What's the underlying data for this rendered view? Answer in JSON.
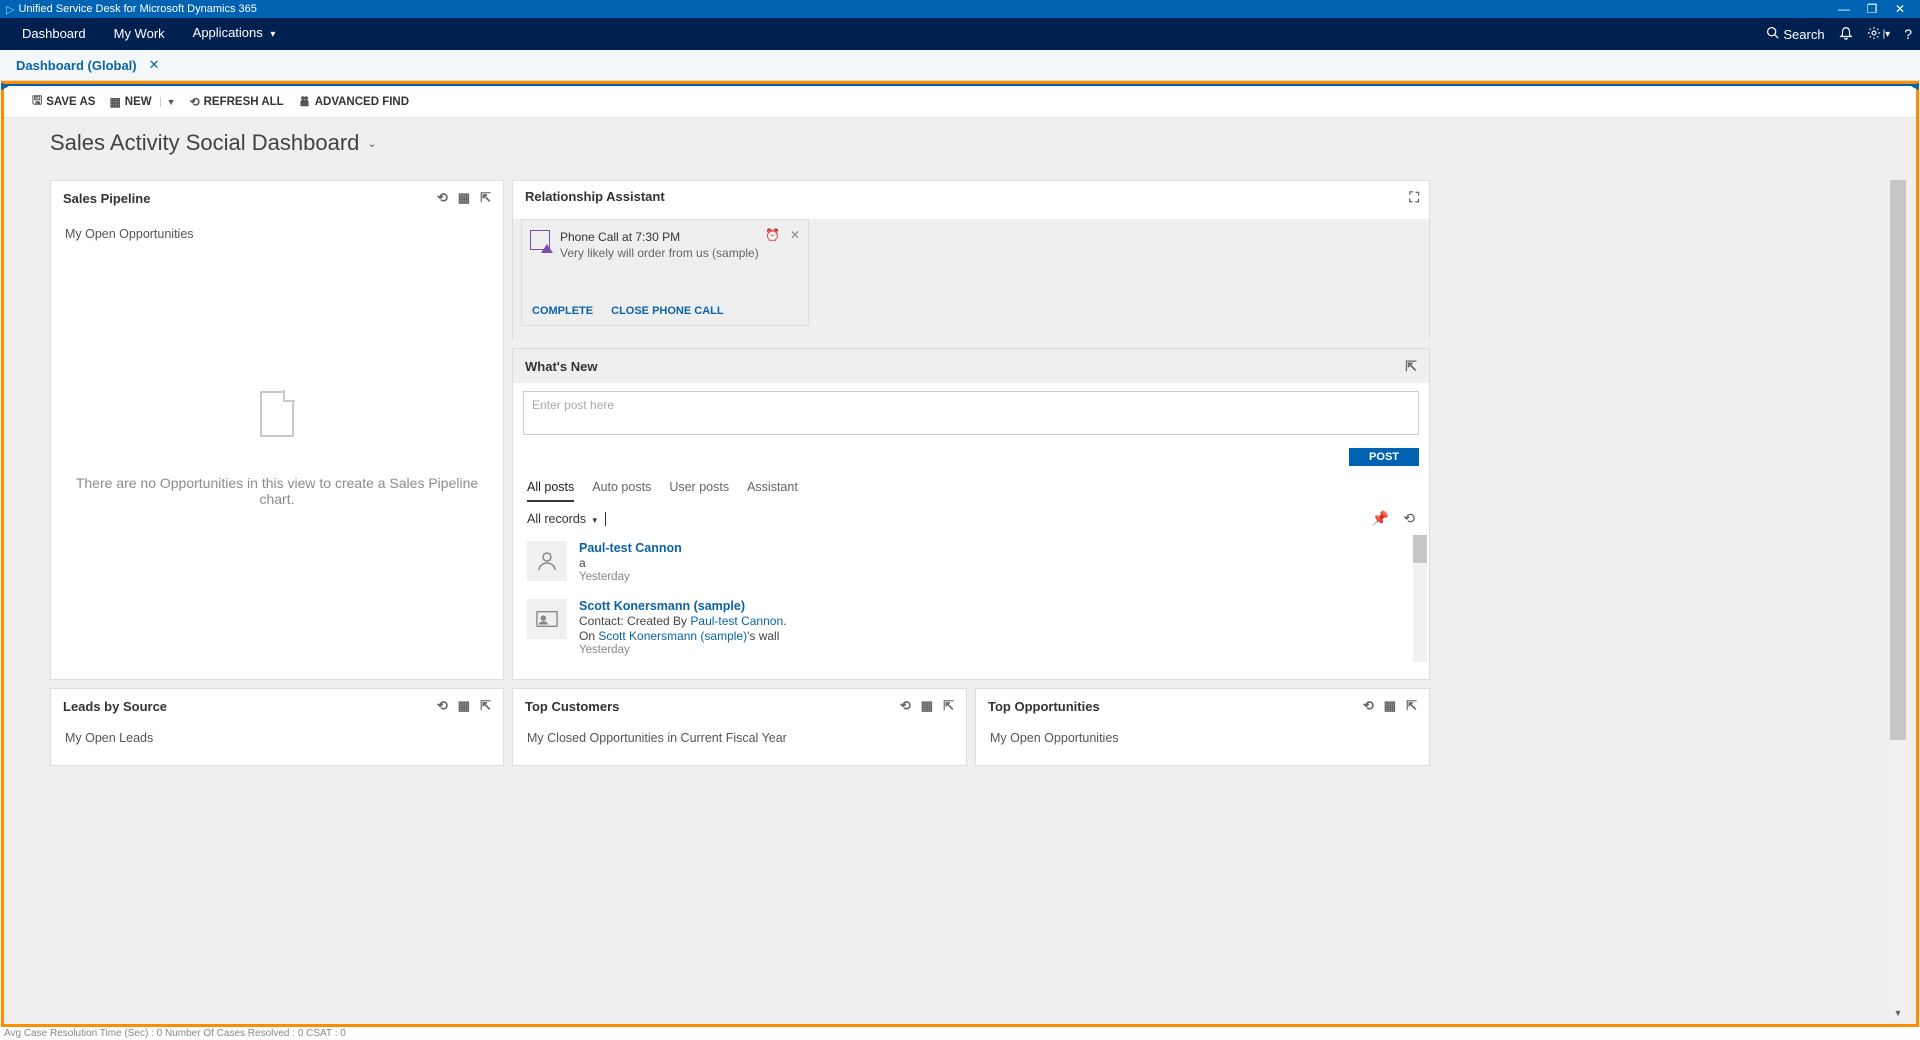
{
  "titlebar": {
    "app_title": "Unified Service Desk for Microsoft Dynamics 365"
  },
  "navbar": {
    "dashboard": "Dashboard",
    "my_work": "My Work",
    "applications": "Applications",
    "search_label": "Search"
  },
  "tabstrip": {
    "tab1": "Dashboard (Global)"
  },
  "toolbar": {
    "save_as": "SAVE AS",
    "new": "NEW",
    "refresh_all": "REFRESH ALL",
    "advanced_find": "ADVANCED FIND"
  },
  "dashboard": {
    "title": "Sales Activity Social Dashboard"
  },
  "sales_pipeline": {
    "title": "Sales Pipeline",
    "subtitle": "My Open Opportunities",
    "empty_text": "There are no Opportunities in this view to create a Sales Pipeline chart."
  },
  "rel_assist": {
    "title": "Relationship Assistant",
    "card": {
      "title": "Phone Call at 7:30 PM",
      "subtitle": "Very likely will order from us (sample)",
      "complete": "COMPLETE",
      "close": "CLOSE PHONE CALL"
    }
  },
  "whats_new": {
    "title": "What's New",
    "placeholder": "Enter post here",
    "post_btn": "POST",
    "tabs": {
      "all_posts": "All posts",
      "auto_posts": "Auto posts",
      "user_posts": "User posts",
      "assistant": "Assistant"
    },
    "filter": "All records",
    "posts": [
      {
        "name": "Paul-test Cannon",
        "text": "a",
        "time": "Yesterday"
      },
      {
        "name": "Scott Konersmann (sample)",
        "prefix": "Contact: Created By ",
        "link1": "Paul-test Cannon",
        "suffix1": ".",
        "line2_prefix": "On ",
        "link2": "Scott Konersmann (sample)",
        "line2_suffix": "'s wall",
        "time": "Yesterday"
      }
    ]
  },
  "bottom": {
    "leads": {
      "title": "Leads by Source",
      "sub": "My Open Leads"
    },
    "top_customers": {
      "title": "Top Customers",
      "sub": "My Closed Opportunities in Current Fiscal Year"
    },
    "top_opps": {
      "title": "Top Opportunities",
      "sub": "My Open Opportunities"
    }
  },
  "statusbar": {
    "text": "Avg Case Resolution Time (Sec) :   0   Number Of Cases Resolved :   0   CSAT :   0"
  }
}
